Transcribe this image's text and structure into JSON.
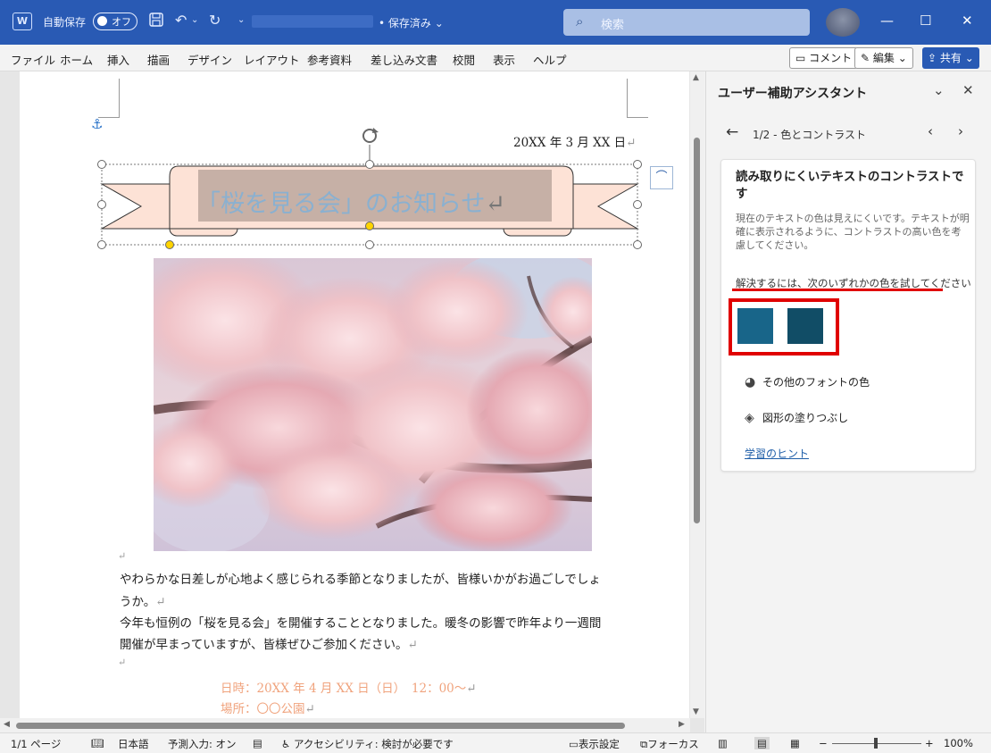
{
  "titlebar": {
    "app_icon_letter": "W",
    "autosave_label": "自動保存",
    "autosave_state": "オフ",
    "save_status": "• 保存済み",
    "search_placeholder": "検索"
  },
  "menu": {
    "items": [
      "ファイル",
      "ホーム",
      "挿入",
      "描画",
      "デザイン",
      "レイアウト",
      "参考資料",
      "差し込み文書",
      "校閲",
      "表示",
      "ヘルプ"
    ],
    "comment_button": "コメント",
    "edit_button": "編集",
    "share_button": "共有"
  },
  "document": {
    "date": "20XX 年 3 月 XX 日",
    "banner_title": "「桜を見る会」のお知らせ",
    "para1_line1": "やわらかな日差しが心地よく感じられる季節となりましたが、皆様いかがお過ごしでしょ",
    "para1_line2": "うか。",
    "para2_line1": "今年も恒例の「桜を見る会」を開催することとなりました。暖冬の影響で昨年より一週間",
    "para2_line2": "開催が早まっていますが、皆様ぜひご参加ください。",
    "event_date": "日時：20XX 年 4 月 XX 日（日）　12：00～",
    "event_place": "場所：〇〇公園",
    "paragraph_mark": "↵",
    "colors": {
      "banner_fill": "#fde2d6",
      "title_highlight": "#c6b0a6",
      "title_text": "#8ab0d0",
      "accent_orange": "#f0a37d"
    }
  },
  "pane": {
    "title": "ユーザー補助アシスタント",
    "nav_label": "1/2 - 色とコントラスト",
    "card": {
      "title": "読み取りにくいテキストのコントラストです",
      "description": "現在のテキストの色は見えにくいです。テキストが明確に表示されるように、コントラストの高い色を考慮してください。",
      "hint": "解決するには、次のいずれかの色を試してください",
      "swatches": [
        "#186589",
        "#114d66"
      ],
      "option_font_color": "その他のフォントの色",
      "option_shape_fill": "図形の塗りつぶし",
      "learn_link": "学習のヒント"
    }
  },
  "status": {
    "page": "1/1 ページ",
    "language": "日本語",
    "prediction": "予測入力: オン",
    "accessibility": "アクセシビリティ: 検討が必要です",
    "display_settings": "表示設定",
    "focus": "フォーカス",
    "zoom": "100%"
  }
}
